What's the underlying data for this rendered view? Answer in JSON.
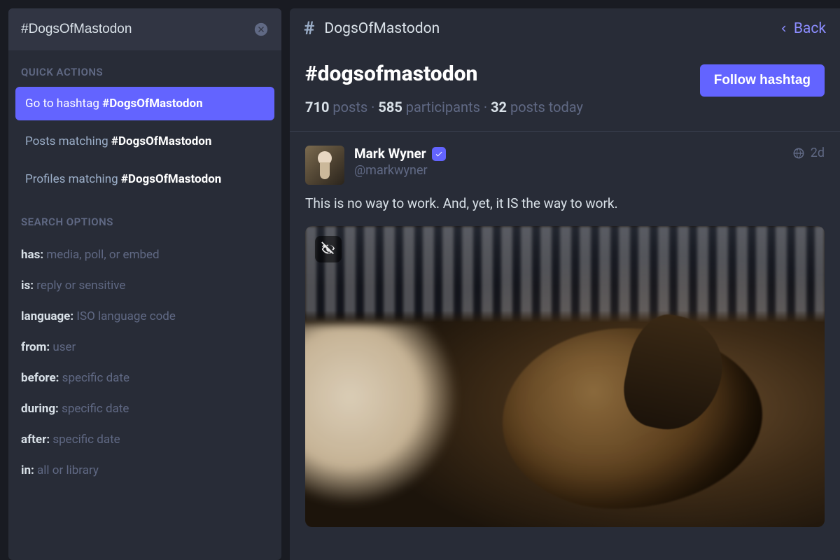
{
  "search": {
    "value": "#DogsOfMastodon"
  },
  "sidebar": {
    "quick_actions_head": "QUICK ACTIONS",
    "qa": [
      {
        "label": "Go to hashtag ",
        "bold": "#DogsOfMastodon",
        "active": true
      },
      {
        "label": "Posts matching ",
        "bold": "#DogsOfMastodon",
        "active": false
      },
      {
        "label": "Profiles matching ",
        "bold": "#DogsOfMastodon",
        "active": false
      }
    ],
    "search_options_head": "SEARCH OPTIONS",
    "filters": [
      {
        "key": "has:",
        "desc": " media, poll, or embed"
      },
      {
        "key": "is:",
        "desc": " reply or sensitive"
      },
      {
        "key": "language:",
        "desc": " ISO language code"
      },
      {
        "key": "from:",
        "desc": " user"
      },
      {
        "key": "before:",
        "desc": " specific date"
      },
      {
        "key": "during:",
        "desc": " specific date"
      },
      {
        "key": "after:",
        "desc": " specific date"
      },
      {
        "key": "in:",
        "desc": " all or library"
      }
    ]
  },
  "topbar": {
    "label": "DogsOfMastodon",
    "back": "Back"
  },
  "tag": {
    "title": "#dogsofmastodon",
    "follow": "Follow hashtag",
    "stats": {
      "posts_n": "710",
      "posts_l": " posts · ",
      "part_n": "585",
      "part_l": " participants · ",
      "today_n": "32",
      "today_l": " posts today"
    }
  },
  "post": {
    "display_name": "Mark Wyner",
    "handle": "@markwyner",
    "time": "2d",
    "body": "This is no way to work. And, yet, it IS the way to work."
  }
}
